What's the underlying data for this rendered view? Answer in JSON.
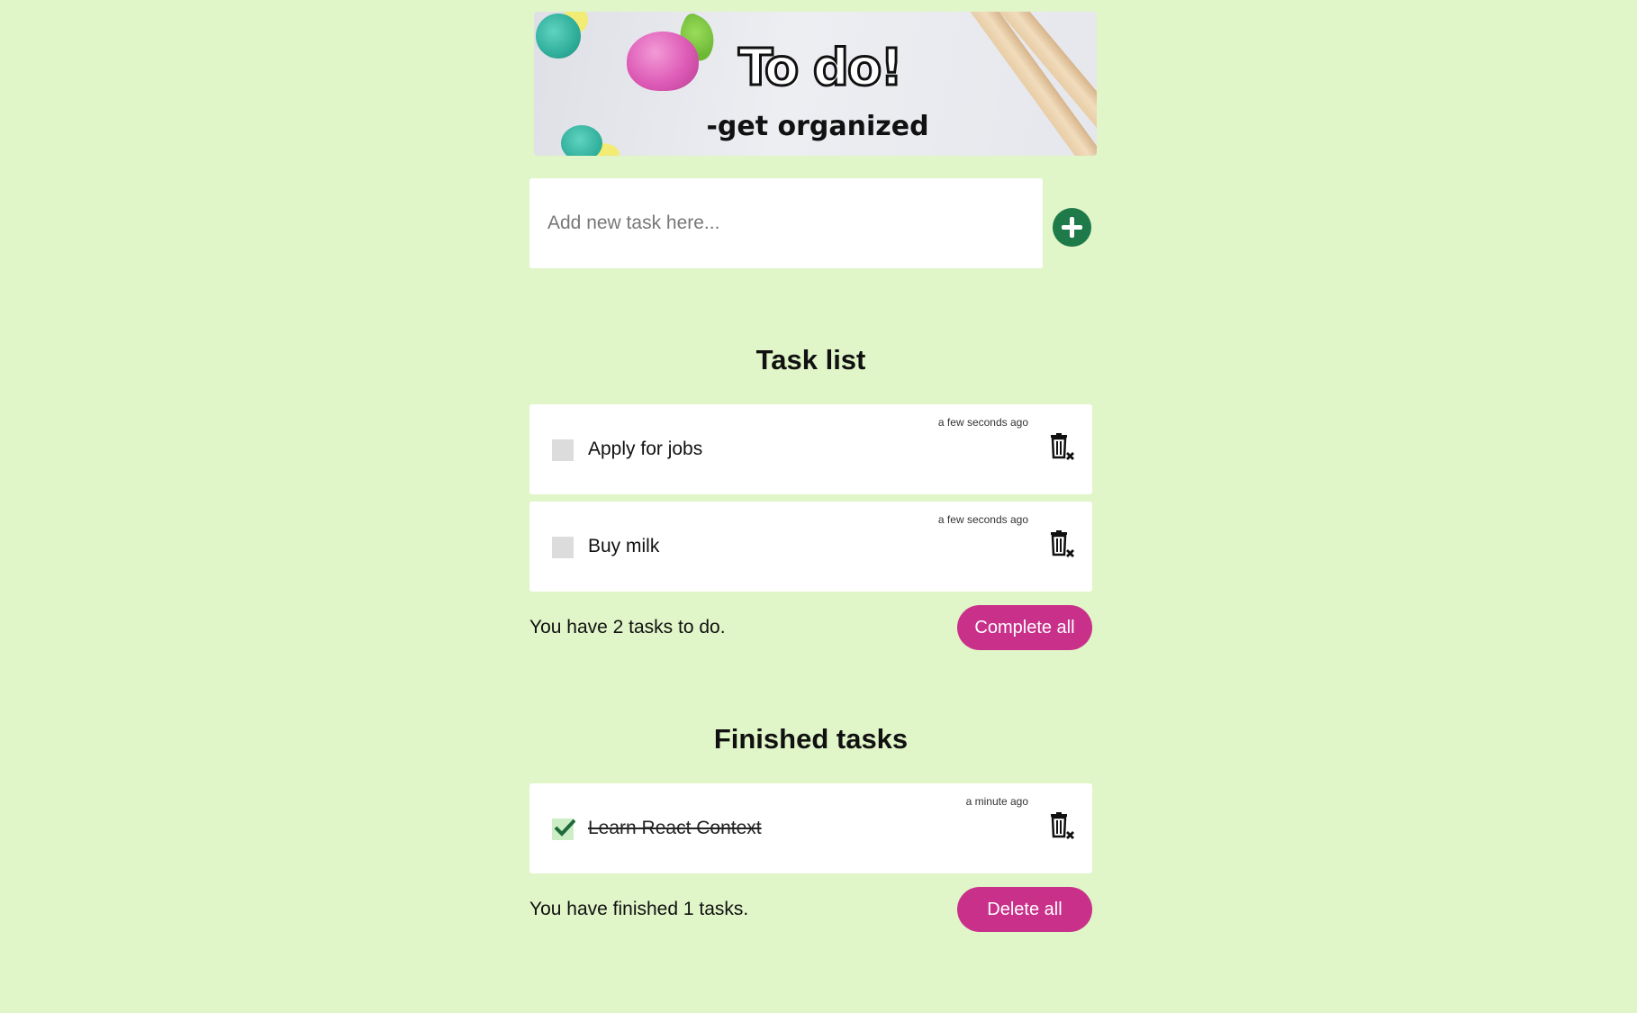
{
  "banner": {
    "title": "To do!",
    "subtitle": "-get organized"
  },
  "new_task": {
    "placeholder": "Add new task here..."
  },
  "task_list": {
    "heading": "Task list",
    "items": [
      {
        "label": "Apply for jobs",
        "time": "a few seconds ago",
        "done": false
      },
      {
        "label": "Buy milk",
        "time": "a few seconds ago",
        "done": false
      }
    ],
    "summary": "You have 2 tasks to do.",
    "action_label": "Complete all"
  },
  "finished_list": {
    "heading": "Finished tasks",
    "items": [
      {
        "label": "Learn React Context",
        "time": "a minute ago",
        "done": true
      }
    ],
    "summary": "You have finished 1 tasks.",
    "action_label": "Delete all"
  },
  "colors": {
    "background": "#e0f5c8",
    "accent_button": "#c9308a",
    "add_button": "#1f7a4a"
  },
  "icons": {
    "add": "plus-circle-icon",
    "delete": "trash-x-icon",
    "check": "checkmark-icon"
  }
}
